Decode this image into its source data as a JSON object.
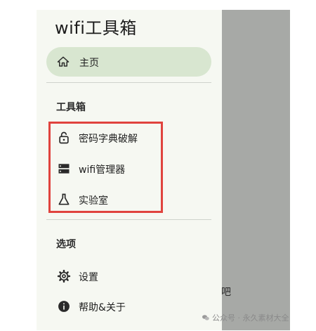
{
  "drawer": {
    "title": "wifi工具箱",
    "home": {
      "label": "主页",
      "icon": "home-icon"
    },
    "toolbox_section": "工具箱",
    "tools": [
      {
        "label": "密码字典破解",
        "icon": "lock-open-icon"
      },
      {
        "label": "wifi管理器",
        "icon": "storage-icon"
      },
      {
        "label": "实验室",
        "icon": "flask-icon"
      }
    ],
    "options_section": "选项",
    "options": [
      {
        "label": "设置",
        "icon": "gear-icon"
      },
      {
        "label": "帮助&关于",
        "icon": "info-icon"
      }
    ]
  },
  "background": {
    "partial_text": "吧"
  },
  "watermark": {
    "text": "公众号 · 永久素材大全",
    "icon": "wechat-icon"
  },
  "colors": {
    "drawer_bg": "#f6f8f2",
    "selected_pill": "#d8e6d0",
    "scrim": "#a7a9a6",
    "highlight_box": "#e0433e"
  }
}
